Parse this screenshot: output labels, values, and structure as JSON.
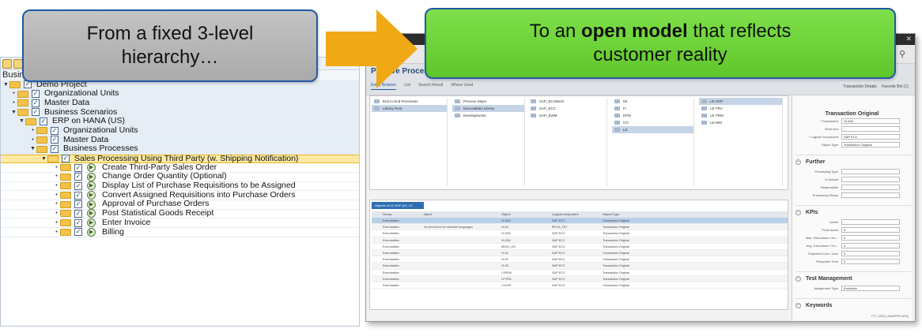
{
  "callouts": {
    "left_line1": "From a fixed 3-level",
    "left_line2": "hierarchy…",
    "right_line1_pre": "To an ",
    "right_line1_bold": "open model",
    "right_line1_post": " that reflects",
    "right_line2": "customer reality"
  },
  "colors": {
    "callout_left_bg": "#b3b3b3",
    "callout_right_bg": "#66cc33",
    "arrow": "#f0a814",
    "callout_border": "#1f5aa6",
    "selected_row": "#fde9a3"
  },
  "tree": {
    "heading": "Busine",
    "rows": [
      {
        "label": "Demo Project",
        "icon": "folder-icon",
        "toggle": "▼"
      },
      {
        "label": "Organizational Units",
        "icon": "folder-icon",
        "toggle": "•"
      },
      {
        "label": "Master Data",
        "icon": "folder-icon",
        "toggle": "•"
      },
      {
        "label": "Business Scenarios",
        "icon": "folder-icon",
        "toggle": "▼"
      },
      {
        "label": "ERP on HANA (US)",
        "icon": "folder-icon",
        "toggle": "▼"
      },
      {
        "label": "Organizational Units",
        "icon": "folder-icon",
        "toggle": "•"
      },
      {
        "label": "Master Data",
        "icon": "folder-icon",
        "toggle": "•"
      },
      {
        "label": "Business Processes",
        "icon": "folder-icon",
        "toggle": "▼"
      },
      {
        "label": "Sales Processing Using Third Party (w. Shipping Notification)",
        "icon": "folder-open-icon",
        "toggle": "▼"
      },
      {
        "label": "Create Third-Party Sales Order",
        "icon": "process-step-icon",
        "toggle": "•"
      },
      {
        "label": "Change Order Quantity (Optional)",
        "icon": "process-step-icon",
        "toggle": "•"
      },
      {
        "label": "Display List of Purchase Requisitions to be Assigned",
        "icon": "process-step-icon",
        "toggle": "•"
      },
      {
        "label": "Convert Assigned Requisitions into Purchase Orders",
        "icon": "process-step-icon",
        "toggle": "•"
      },
      {
        "label": "Approval of Purchase Orders",
        "icon": "process-step-icon",
        "toggle": "•"
      },
      {
        "label": "Post Statistical Goods Receipt",
        "icon": "process-step-icon",
        "toggle": "•"
      },
      {
        "label": "Enter Invoice",
        "icon": "process-step-icon",
        "toggle": "•"
      },
      {
        "label": "Billing",
        "icon": "process-step-icon",
        "toggle": "•"
      }
    ]
  },
  "app": {
    "header_title": "Pro    tive Process",
    "tabs": [
      "Entity Browser",
      "List",
      "Search Result",
      "Where Used"
    ],
    "header_right": [
      "Transaction Details",
      "Favorite Bin (1)"
    ],
    "columns": [
      {
        "items": [
          "End to End Processes",
          "Library Root"
        ],
        "selected": 1
      },
      {
        "items": [
          "Process Steps",
          "Executables Library",
          "Developments"
        ],
        "selected": 1
      },
      {
        "items": [
          "SAP_ECUMAN",
          "SAP_ECC",
          "SAP_EWM"
        ],
        "selected": -1
      },
      {
        "items": [
          "MI",
          "FI",
          "EPM",
          "CO",
          "LE"
        ],
        "selected": 4
      },
      {
        "items": [
          "LE-SHP",
          "LE-TRA",
          "LE-TRM",
          "LE-WM"
        ],
        "selected": 0
      }
    ],
    "objects_tab": "Objects of LE-SHP (LE, LE",
    "object_headers": [
      "Group",
      "Name",
      "Object",
      "Logical component",
      "Object Type"
    ],
    "object_rows": [
      [
        "Executables",
        "",
        "VL31N",
        "SAP ECC",
        "Transaction Original"
      ],
      [
        "Executables",
        "No text found for selected languages",
        "VL10",
        "BPOA_FAT",
        "Transaction Original"
      ],
      [
        "Executables",
        "",
        "VL32N",
        "SAP ECC",
        "Transaction Original"
      ],
      [
        "Executables",
        "",
        "VL33N",
        "SAP ECC",
        "Transaction Original"
      ],
      [
        "Executables",
        "",
        "MIGO_GR",
        "SAP ECC",
        "Transaction Original"
      ],
      [
        "Executables",
        "",
        "VL31",
        "SAP ECC",
        "Transaction Original"
      ],
      [
        "Executables",
        "",
        "VL32",
        "SAP ECC",
        "Transaction Original"
      ],
      [
        "Executables",
        "",
        "VL33",
        "SAP ECC",
        "Transaction Original"
      ],
      [
        "Executables",
        "",
        "LYREM",
        "SAP ECC",
        "Transaction Original"
      ],
      [
        "Executables",
        "",
        "LPYRD",
        "SAP ECC",
        "Transaction Original"
      ],
      [
        "Executables",
        "",
        "LYGHP",
        "SAP ECC",
        "Transaction Original"
      ]
    ],
    "detail_title": "Transaction Original",
    "detail_fields": [
      {
        "k": "* Transaction",
        "v": "VL31N"
      },
      {
        "k": "Short text",
        "v": ""
      },
      {
        "k": "* Logical Component",
        "v": "SAP ECC"
      },
      {
        "k": "Object Type",
        "v": "Transaction Original"
      }
    ],
    "sections": [
      "Further",
      "KPIs",
      "Test Management",
      "Keywords"
    ],
    "further_fields": [
      {
        "k": "Processing Type",
        "v": ""
      },
      {
        "k": "Is Default",
        "v": ""
      },
      {
        "k": "Responsible",
        "v": ""
      },
      {
        "k": "Processing Status",
        "v": ""
      }
    ],
    "kpi_fields": [
      {
        "k": "Active",
        "v": ""
      },
      {
        "k": "Peak-hours",
        "v": "0"
      },
      {
        "k": "Max. Executions / Ho...",
        "v": "0"
      },
      {
        "k": "Avg. Executions / Ho...",
        "v": "0"
      },
      {
        "k": "Expected Conc. User",
        "v": "0"
      },
      {
        "k": "Response Time",
        "v": "0"
      }
    ],
    "test_fields": [
      {
        "k": "Assignment Type",
        "v": "Exclusive"
      }
    ],
    "status": "FT7 (200) | ANAPPM (EN)"
  }
}
